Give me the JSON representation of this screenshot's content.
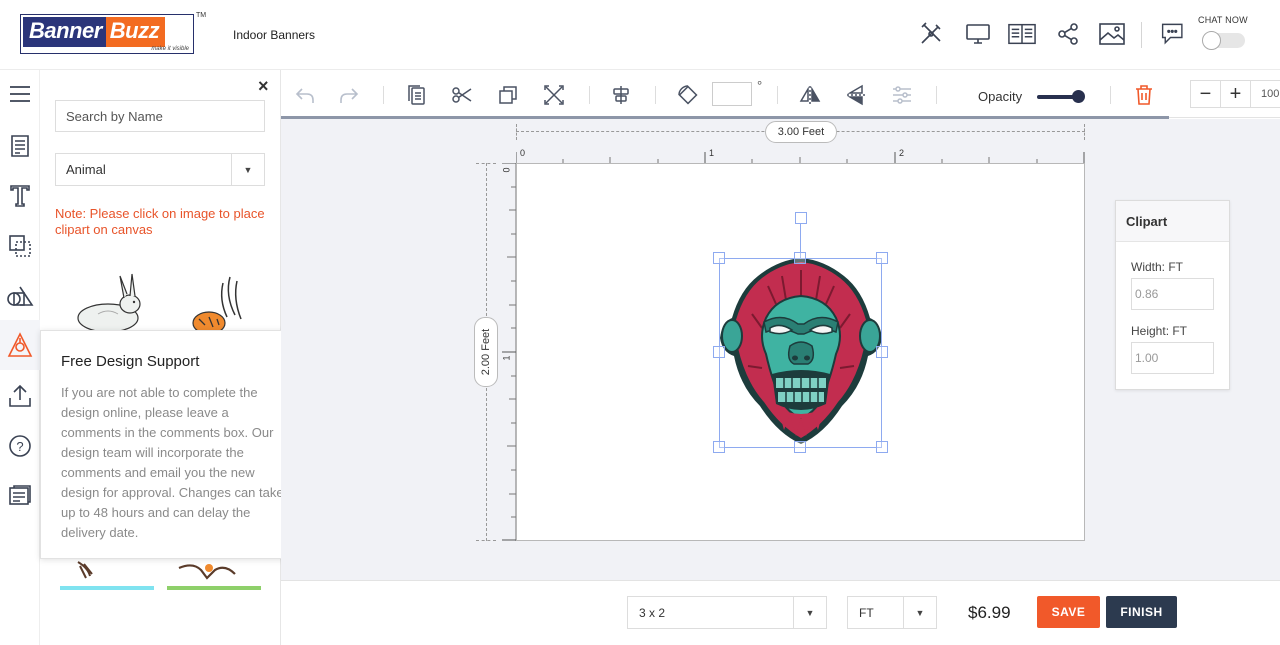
{
  "header": {
    "brand_part1": "Banner",
    "brand_part2": "Buzz",
    "brand_tagline": "make it visible",
    "trademark": "TM",
    "page_name": "Indoor Banners",
    "chat_label": "CHAT NOW",
    "icons": [
      "design-tools-icon",
      "monitor-preview-icon",
      "book-guide-icon",
      "share-icon",
      "image-gallery-icon",
      "chat-icon"
    ]
  },
  "rail": {
    "icons": [
      "menu-icon",
      "template-icon",
      "text-icon",
      "layers-icon",
      "shapes-icon",
      "clipart-icon",
      "upload-icon",
      "help-icon",
      "comments-icon"
    ]
  },
  "panel": {
    "search_placeholder": "Search by Name",
    "category": "Animal",
    "note": "Note: Please click on image to place clipart on canvas"
  },
  "popup": {
    "title": "Free Design Support",
    "body": "If you are not able to complete the design online, please leave a comments in the comments box. Our design team will incorporate the comments and email you the new design for approval. Changes can take up to 48 hours and can delay the delivery date."
  },
  "toolbar": {
    "degree_symbol": "°",
    "opacity_label": "Opacity",
    "opacity_value": 1.0,
    "zoom_minus": "−",
    "zoom_plus": "+",
    "zoom_value": "100"
  },
  "canvas": {
    "width_label": "3.00 Feet",
    "height_label": "2.00 Feet",
    "ruler_h": [
      "0",
      "1",
      "2"
    ],
    "ruler_v": [
      "0",
      "1"
    ]
  },
  "props": {
    "title": "Clipart",
    "width_label": "Width: FT",
    "width_value": "0.86",
    "height_label": "Height: FT",
    "height_value": "1.00"
  },
  "bottom": {
    "size": "3 x 2",
    "unit": "FT",
    "price": "$6.99",
    "save_label": "SAVE",
    "finish_label": "FINISH"
  },
  "colors": {
    "accent_orange": "#f1592a",
    "dark_navy": "#2c3a4f",
    "note_red": "#e8542a",
    "selection_blue": "#8eaaf0"
  }
}
